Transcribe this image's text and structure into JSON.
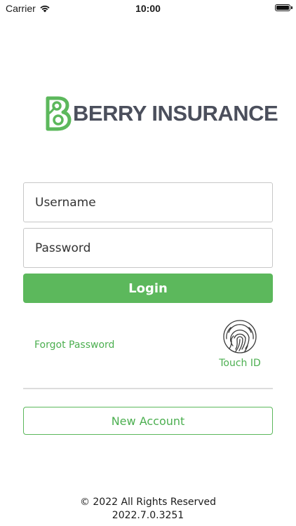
{
  "status_bar": {
    "carrier": "Carrier",
    "time": "10:00",
    "wifi_icon": "wifi-icon",
    "battery_icon": "battery-icon"
  },
  "brand": {
    "name": "BERRY INSURANCE",
    "logo_icon": "berry-b-logo-icon",
    "green": "#5cb85c",
    "text_gray": "#4b4f5c"
  },
  "login_form": {
    "username_placeholder": "Username",
    "username_value": "",
    "password_placeholder": "Password",
    "password_value": "",
    "login_label": "Login"
  },
  "links": {
    "forgot_password": "Forgot Password",
    "touch_id": "Touch ID",
    "touch_id_icon": "fingerprint-icon"
  },
  "new_account_label": "New Account",
  "footer": {
    "copyright": "© 2022 All Rights Reserved",
    "version": "2022.7.0.3251"
  }
}
